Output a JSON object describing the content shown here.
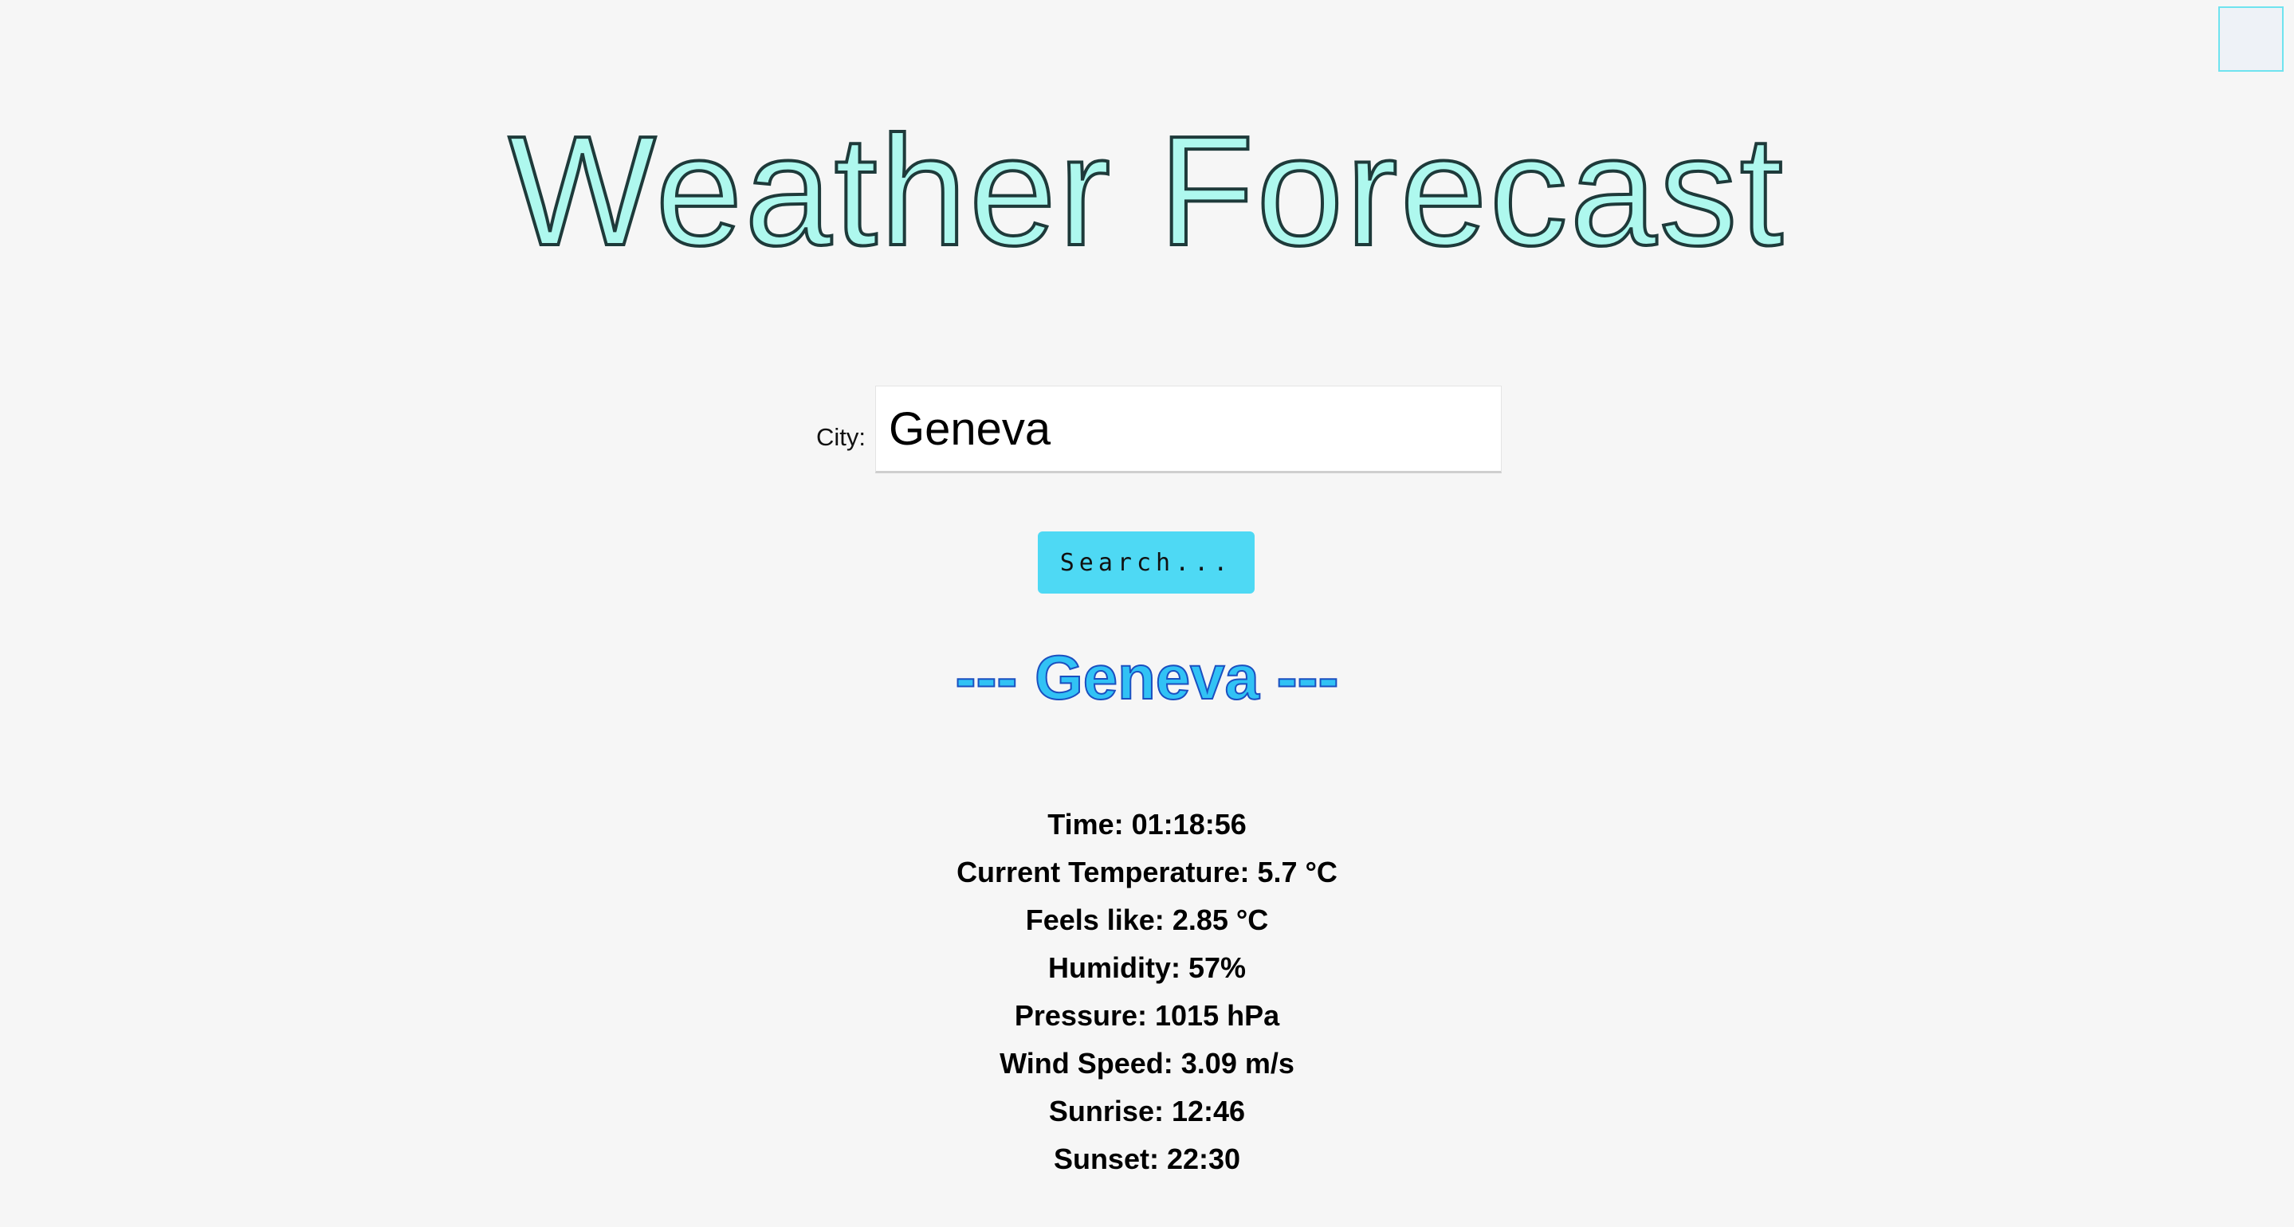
{
  "header": {
    "title": "Weather Forecast"
  },
  "search": {
    "city_label": "City:",
    "city_value": "Geneva",
    "button_label": "Search..."
  },
  "result": {
    "heading": "--- Geneva ---",
    "details": [
      {
        "label": "Time:",
        "value": "01:18:56"
      },
      {
        "label": "Current Temperature:",
        "value": "5.7 °C"
      },
      {
        "label": "Feels like:",
        "value": "2.85 °C"
      },
      {
        "label": "Humidity:",
        "value": "57%"
      },
      {
        "label": "Pressure:",
        "value": "1015 hPa"
      },
      {
        "label": "Wind Speed:",
        "value": "3.09 m/s"
      },
      {
        "label": "Sunrise:",
        "value": "12:46"
      },
      {
        "label": "Sunset:",
        "value": "22:30"
      }
    ]
  },
  "colors": {
    "background": "#f6f6f6",
    "title_fill": "#aef8ee",
    "title_stroke": "#1e3a3a",
    "button_bg": "#4ed9f4",
    "result_heading_fill": "#31c2f5",
    "result_heading_stroke": "#1b4fc0"
  }
}
